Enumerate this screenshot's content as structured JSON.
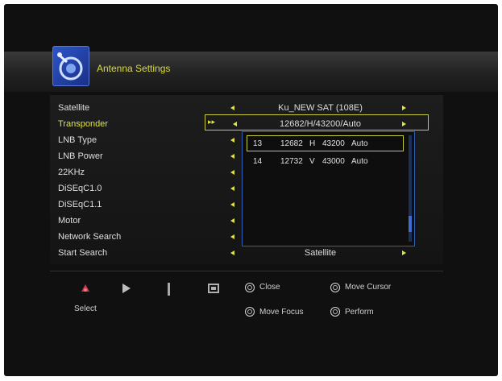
{
  "menu": {
    "title": "Antenna Settings"
  },
  "settings": [
    {
      "label": "Satellite",
      "value": "Ku_NEW SAT (108E)",
      "selected": false
    },
    {
      "label": "Transponder",
      "value": "12682/H/43200/Auto",
      "selected": true
    },
    {
      "label": "LNB Type",
      "value": "",
      "selected": false
    },
    {
      "label": "LNB Power",
      "value": "",
      "selected": false
    },
    {
      "label": "22KHz",
      "value": "",
      "selected": false
    },
    {
      "label": "DiSEqC1.0",
      "value": "",
      "selected": false
    },
    {
      "label": "DiSEqC1.1",
      "value": "",
      "selected": false
    },
    {
      "label": "Motor",
      "value": "",
      "selected": false
    },
    {
      "label": "Network Search",
      "value": "",
      "selected": false
    },
    {
      "label": "Start Search",
      "value": "Satellite",
      "selected": false
    }
  ],
  "transponder_list": [
    {
      "num": "13",
      "freq": "12682",
      "pol": "H",
      "sym": "43200",
      "mode": "Auto",
      "highlighted": true
    },
    {
      "num": "14",
      "freq": "12732",
      "pol": "V",
      "sym": "43000",
      "mode": "Auto",
      "highlighted": false
    }
  ],
  "skip_indicator": "▸▸",
  "footer": {
    "select_label": "Select",
    "close_label": "Close",
    "move_cursor_label": "Move Cursor",
    "move_focus_label": "Move Focus",
    "perform_label": "Perform"
  },
  "colors": {
    "accent": "#e2e441",
    "list_border": "#2d5fb5",
    "background": "#101010"
  }
}
